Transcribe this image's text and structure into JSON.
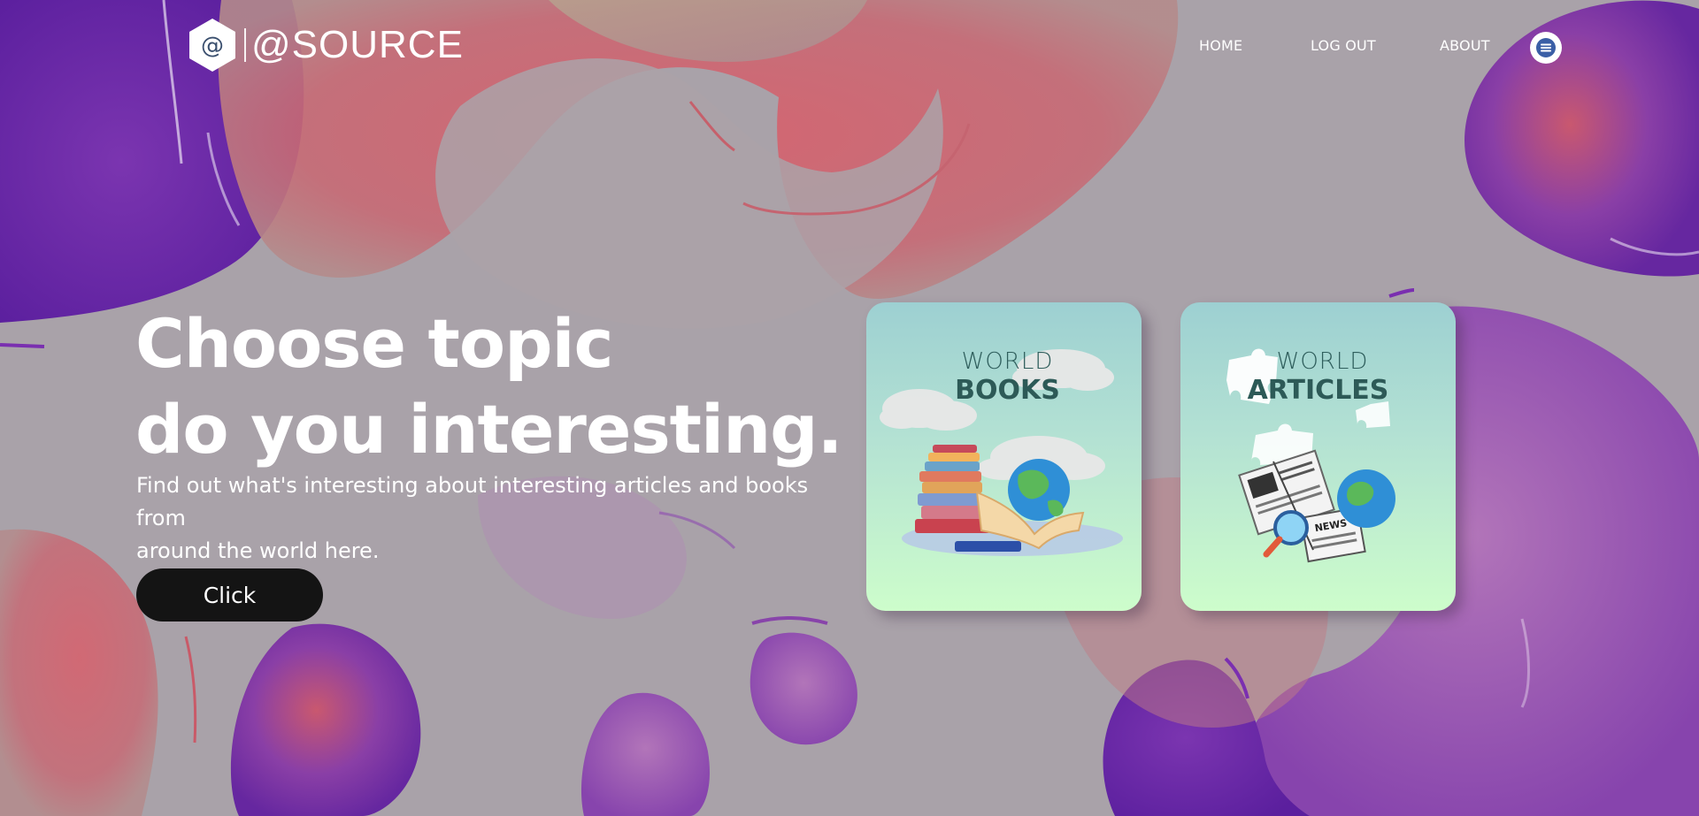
{
  "brand": {
    "logo_text": "@SOURCE",
    "logo_mark": "@"
  },
  "nav": {
    "home": "HOME",
    "logout": "LOG OUT",
    "about": "ABOUT",
    "menu_icon": "hamburger-menu-icon"
  },
  "hero": {
    "headline_line1": "Choose topic",
    "headline_line2": "do you interesting.",
    "subtext_line1": "Find out what's interesting about interesting articles and books from",
    "subtext_line2": "around the world here.",
    "cta_label": "Click"
  },
  "cards": [
    {
      "line1": "WORLD",
      "line2": "BOOKS",
      "illustration": "books-and-globe"
    },
    {
      "line1": "WORLD",
      "line2": "ARTICLES",
      "illustration": "newspapers-globe-magnifier"
    }
  ],
  "colors": {
    "accent_purple": "#6a2aa6",
    "blob_coral": "#c9646e",
    "button_bg": "#141414",
    "card_top": "#9dd0d2",
    "card_bottom": "#cdfdcb",
    "card_title": "#2d5a57"
  }
}
